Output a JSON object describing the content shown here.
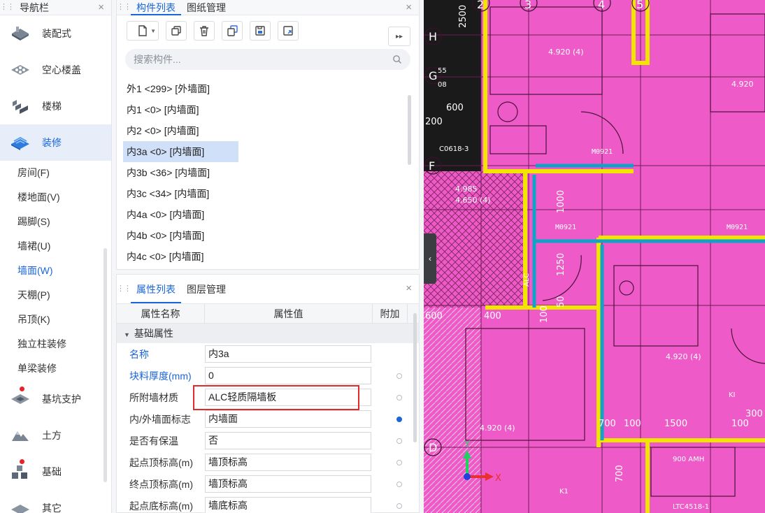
{
  "nav": {
    "title": "导航栏",
    "close": "×",
    "main_items": [
      {
        "label": "装配式",
        "icon": "prefab-icon",
        "dot": false
      },
      {
        "label": "空心楼盖",
        "icon": "hollow-floor-icon",
        "dot": false
      },
      {
        "label": "楼梯",
        "icon": "stairs-icon",
        "dot": false
      },
      {
        "label": "装修",
        "icon": "decoration-icon",
        "dot": false,
        "active": true
      }
    ],
    "sub_items": [
      {
        "label": "房间(F)"
      },
      {
        "label": "楼地面(V)"
      },
      {
        "label": "踢脚(S)"
      },
      {
        "label": "墙裙(U)"
      },
      {
        "label": "墙面(W)",
        "active": true
      },
      {
        "label": "天棚(P)"
      },
      {
        "label": "吊顶(K)"
      },
      {
        "label": "独立柱装修"
      },
      {
        "label": "单梁装修"
      }
    ],
    "more_items": [
      {
        "label": "基坑支护",
        "icon": "foundation-pit-icon",
        "dot": true
      },
      {
        "label": "土方",
        "icon": "earthwork-icon",
        "dot": false
      },
      {
        "label": "基础",
        "icon": "foundation-icon",
        "dot": true
      },
      {
        "label": "其它",
        "icon": "other-icon",
        "dot": false
      }
    ]
  },
  "components": {
    "tab_active": "构件列表",
    "tab_other": "图纸管理",
    "close": "×",
    "expand": "▸▸",
    "search_placeholder": "搜索构件...",
    "items": [
      {
        "label": "外1 <299> [外墙面]"
      },
      {
        "label": "内1 <0> [内墙面]"
      },
      {
        "label": "内2 <0> [内墙面]"
      },
      {
        "label": "内3a <0> [内墙面]",
        "selected": true
      },
      {
        "label": "内3b <36> [内墙面]"
      },
      {
        "label": "内3c <34> [内墙面]"
      },
      {
        "label": "内4a <0> [内墙面]"
      },
      {
        "label": "内4b <0> [内墙面]"
      },
      {
        "label": "内4c <0> [内墙面]"
      }
    ]
  },
  "properties": {
    "tab_active": "属性列表",
    "tab_other": "图层管理",
    "close": "×",
    "col_name": "属性名称",
    "col_value": "属性值",
    "col_extra": "附加",
    "group": "基础属性",
    "rows": [
      {
        "name": "名称",
        "value": "内3a",
        "blue": true,
        "radio": "none"
      },
      {
        "name": "块料厚度(mm)",
        "value": "0",
        "blue": true,
        "radio": "off"
      },
      {
        "name": "所附墙材质",
        "value": "ALC轻质隔墙板",
        "blue": false,
        "radio": "off"
      },
      {
        "name": "内/外墙面标志",
        "value": "内墙面",
        "blue": false,
        "radio": "on"
      },
      {
        "name": "是否有保温",
        "value": "否",
        "blue": false,
        "radio": "off"
      },
      {
        "name": "起点顶标高(m)",
        "value": "墙顶标高",
        "blue": false,
        "radio": "off"
      },
      {
        "name": "终点顶标高(m)",
        "value": "墙顶标高",
        "blue": false,
        "radio": "off"
      },
      {
        "name": "起点底标高(m)",
        "value": "墙底标高",
        "blue": false,
        "radio": "off"
      }
    ]
  },
  "cad": {
    "background": "#ee5bc8",
    "axis_labels": [
      "H",
      "G",
      "F",
      "D"
    ],
    "col_labels": [
      "2",
      "3",
      "4",
      "5"
    ],
    "dims": [
      "2500",
      "600",
      "200",
      "1000",
      "1250",
      "600",
      "400",
      "100",
      "50",
      "700",
      "100",
      "1500",
      "100",
      "300",
      "700"
    ],
    "door_labels": [
      "M0921",
      "M0921",
      "M0921"
    ],
    "elev_texts": [
      "4.920 (4)",
      "4.920",
      "4.985",
      "4.650 (4)",
      "4.920 (4)",
      "4.920 (4)"
    ],
    "misc": [
      "900 AMH",
      "LTC4518-1",
      "C0618-3",
      "K1",
      "KI",
      "55",
      "08",
      "ALC",
      "X",
      "Y"
    ]
  }
}
